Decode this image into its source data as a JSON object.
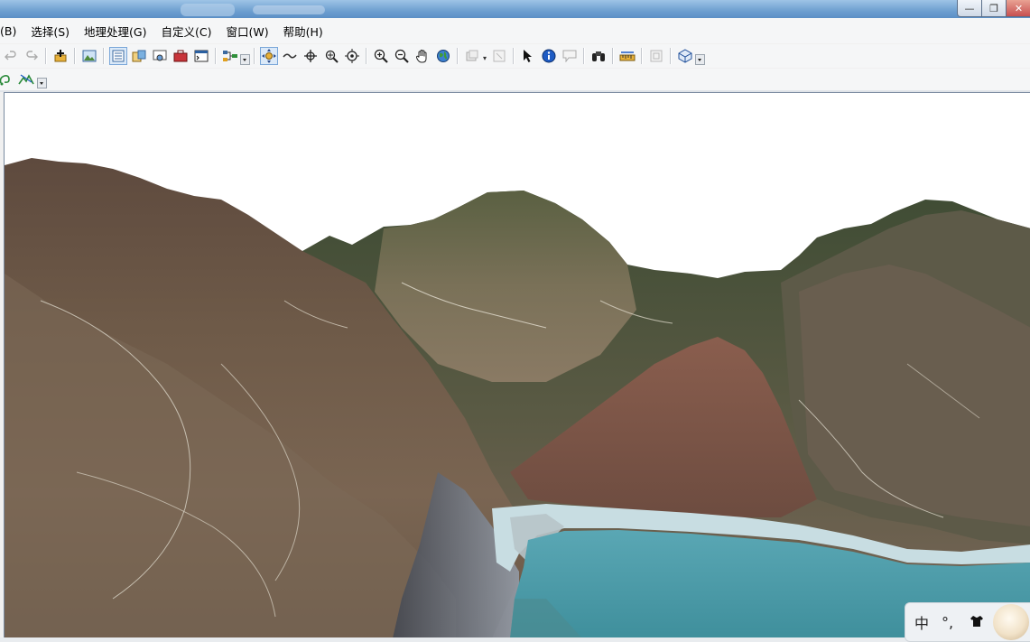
{
  "menu": {
    "items": [
      {
        "label": "(B)"
      },
      {
        "label": "选择(S)"
      },
      {
        "label": "地理处理(G)"
      },
      {
        "label": "自定义(C)"
      },
      {
        "label": "窗口(W)"
      },
      {
        "label": "帮助(H)"
      }
    ]
  },
  "window_controls": {
    "minimize": "—",
    "maximize": "❐",
    "close": "✕"
  },
  "ime": {
    "language": "中",
    "punctuation": "°,"
  },
  "colors": {
    "sky": "#ffffff",
    "water": "#4a9aa8",
    "mountain_dark": "#4e5a3a",
    "mountain_brown": "#8a6a55",
    "shore": "#c8dde2"
  }
}
